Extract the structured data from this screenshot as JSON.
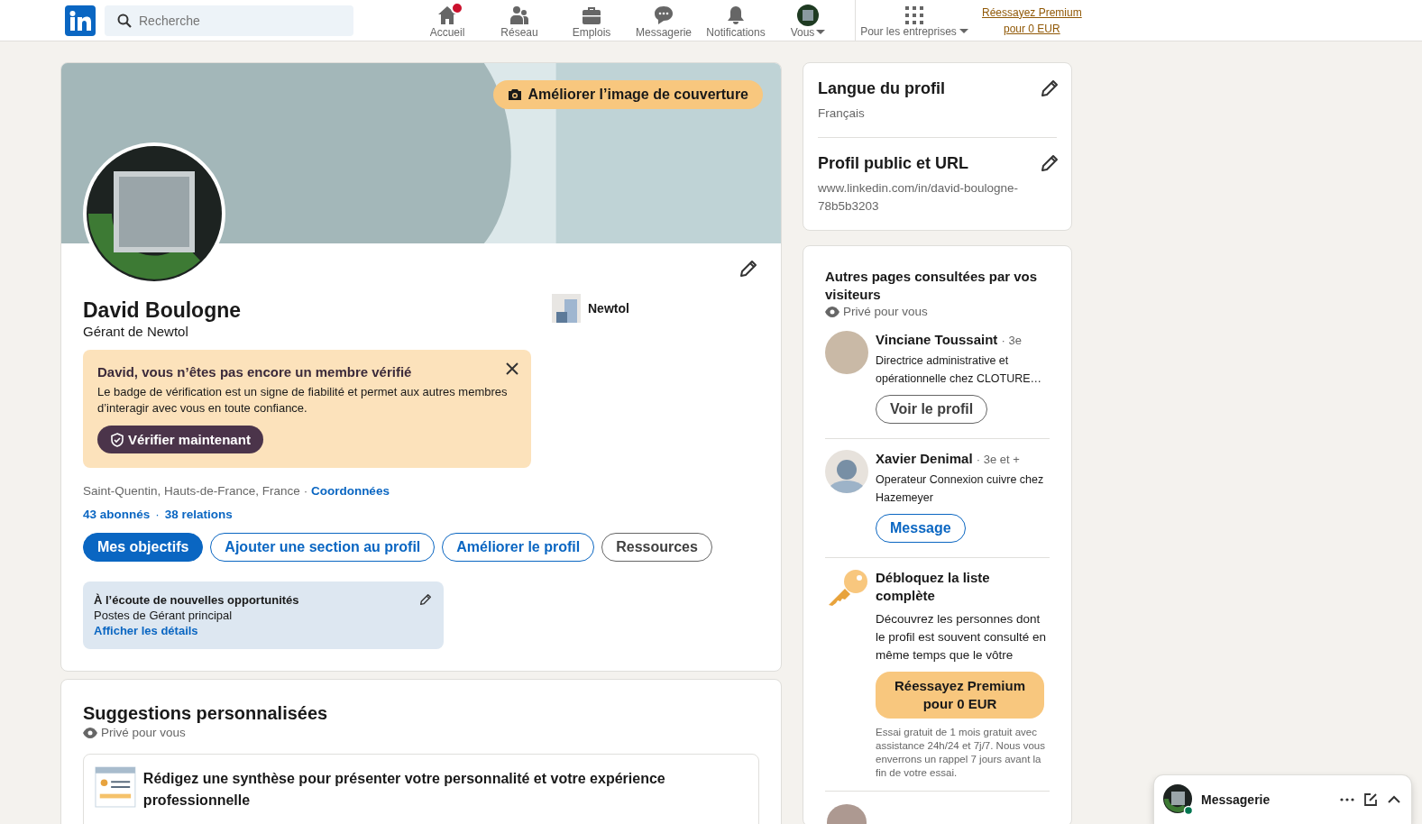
{
  "header": {
    "search": {
      "placeholder": "Recherche"
    },
    "nav": [
      {
        "label": "Accueil",
        "badge": true,
        "dropdown": false
      },
      {
        "label": "Réseau",
        "badge": false,
        "dropdown": false
      },
      {
        "label": "Emplois",
        "badge": false,
        "dropdown": false
      },
      {
        "label": "Messagerie",
        "badge": false,
        "dropdown": false
      },
      {
        "label": "Notifications",
        "badge": false,
        "dropdown": false
      },
      {
        "label": "Vous",
        "badge": false,
        "dropdown": true
      }
    ],
    "business": {
      "label": "Pour les entreprises"
    },
    "premium_link": [
      "Réessayez Premium",
      "pour 0 EUR"
    ]
  },
  "profile": {
    "cover_button": "Améliorer l’image de couverture",
    "name": "David Boulogne",
    "headline": "Gérant de Newtol",
    "company": "Newtol",
    "verify": {
      "title": "David, vous n’êtes pas encore un membre vérifié",
      "text": "Le badge de vérification est un signe de fiabilité et permet aux autres membres d’interagir avec vous en toute confiance.",
      "button": "Vérifier maintenant"
    },
    "location": "Saint-Quentin, Hauts-de-France, France",
    "contact_separator": "·",
    "contact_link": "Coordonnées",
    "followers": "43 abonnés",
    "stats_separator": "·",
    "connections": "38 relations",
    "actions": [
      {
        "label": "Mes objectifs",
        "kind": "primary"
      },
      {
        "label": "Ajouter une section au profil",
        "kind": "outline"
      },
      {
        "label": "Améliorer le profil",
        "kind": "outline"
      },
      {
        "label": "Ressources",
        "kind": "secondary"
      }
    ],
    "open_to_work": {
      "title": "À l’écoute de nouvelles opportunités",
      "text": "Postes de Gérant principal",
      "link": "Afficher les détails"
    }
  },
  "suggestions": {
    "title": "Suggestions personnalisées",
    "privacy": "Privé pour vous",
    "items": [
      {
        "text": "Rédigez une synthèse pour présenter votre personnalité et votre expérience professionnelle"
      }
    ]
  },
  "settings": [
    {
      "title": "Langue du profil",
      "value": "Français"
    },
    {
      "title": "Profil public et URL",
      "value": "www.linkedin.com/in/david-boulogne-78b5b3203"
    }
  ],
  "viewers": {
    "title": "Autres pages consultées par vos visiteurs",
    "privacy": "Privé pour vous",
    "people": [
      {
        "name": "Vinciane Toussaint",
        "degree": "· 3e",
        "headline": "Directrice administrative et opérationnelle chez CLOTURE…",
        "kind": "photo",
        "button": {
          "label": "Voir le profil",
          "kind": "secondary"
        }
      },
      {
        "name": "Xavier Denimal",
        "degree": "· 3e et +",
        "headline": "Operateur Connexion cuivre chez Hazemeyer",
        "kind": "silhouette",
        "button": {
          "label": "Message",
          "kind": "outline"
        }
      }
    ],
    "upsell": {
      "title": "Débloquez la liste complète",
      "text": "Découvrez les personnes dont le profil est souvent consulté en même temps que le vôtre",
      "button": "Réessayez Premium pour 0 EUR",
      "note": "Essai gratuit de 1 mois gratuit avec assistance 24h/24 et 7j/7. Nous vous enverrons un rappel 7 jours avant la fin de votre essai."
    }
  },
  "messaging": {
    "title": "Messagerie"
  }
}
